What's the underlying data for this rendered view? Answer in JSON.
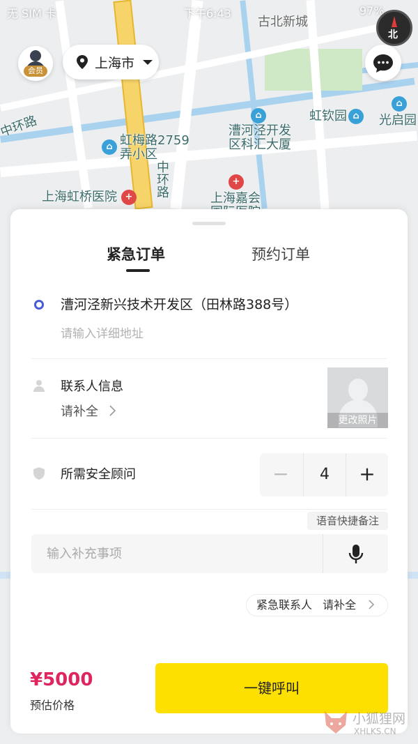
{
  "status_bar": {
    "carrier": "无 SIM 卡",
    "time": "下午6:43",
    "battery": "97%"
  },
  "map": {
    "labels": [
      "古北新城",
      "虹梅路2759弄小区",
      "漕河泾开发区科汇大厦",
      "虹钦园",
      "光启园",
      "上海虹桥医院",
      "上海嘉会国际医院",
      "中环路",
      "中环路"
    ],
    "compass": "北"
  },
  "header": {
    "vip_badge": "会员",
    "city": "上海市"
  },
  "sheet": {
    "tabs": [
      {
        "label": "紧急订单",
        "active": true
      },
      {
        "label": "预约订单",
        "active": false
      }
    ],
    "address": {
      "main": "漕河泾新兴技术开发区（田林路388号）",
      "detail_placeholder": "请输入详细地址"
    },
    "contact": {
      "label": "联系人信息",
      "sub": "请补全",
      "photo_label": "更改照片"
    },
    "advisor": {
      "label": "所需安全顾问",
      "count": "4",
      "minus": "−",
      "plus": "+"
    },
    "voice_note": "语音快捷备注",
    "notes_placeholder": "输入补充事项",
    "emergency": {
      "label": "紧急联系人",
      "action": "请补全"
    },
    "price": {
      "amount": "¥5000",
      "label": "预估价格"
    },
    "call_button": "一键呼叫"
  },
  "watermark": {
    "text": "小狐狸网",
    "sub": "XHLKS.CN"
  },
  "colors": {
    "accent": "#fde000",
    "price": "#e0245e",
    "address_dot": "#4a5bd6"
  }
}
